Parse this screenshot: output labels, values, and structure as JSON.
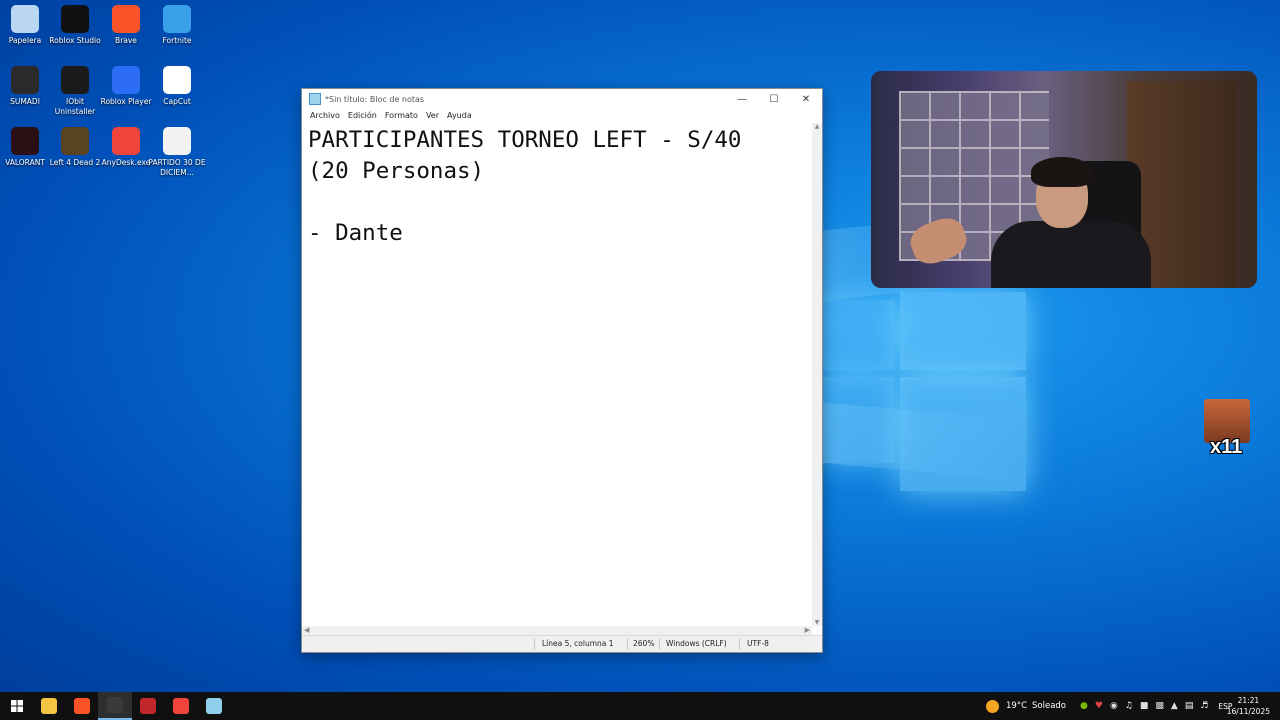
{
  "desktop": {
    "icons": [
      {
        "label": "Papelera",
        "icon": "recycle-bin-icon",
        "color": "#b9d7f0"
      },
      {
        "label": "Roblox Studio",
        "icon": "roblox-studio-icon",
        "color": "#111111"
      },
      {
        "label": "Brave",
        "icon": "brave-icon",
        "color": "#fb542b"
      },
      {
        "label": "Fortnite",
        "icon": "fortnite-icon",
        "color": "#3aa0e8"
      },
      {
        "label": "SUMADI",
        "icon": "sumadi-icon",
        "color": "#2a2a2a"
      },
      {
        "label": "IObit Uninstaller",
        "icon": "iobit-uninstaller-icon",
        "color": "#1a1a1a"
      },
      {
        "label": "Roblox Player",
        "icon": "roblox-player-icon",
        "color": "#2d6df6"
      },
      {
        "label": "CapCut",
        "icon": "capcut-icon",
        "color": "#ffffff"
      },
      {
        "label": "VALORANT",
        "icon": "valorant-icon",
        "color": "#2a0f14"
      },
      {
        "label": "Left 4 Dead 2",
        "icon": "left4dead2-icon",
        "color": "#5a4320"
      },
      {
        "label": "AnyDesk.exe",
        "icon": "anydesk-icon",
        "color": "#ef443b"
      },
      {
        "label": "PARTIDO 30 DE DICIEM...",
        "icon": "text-file-icon",
        "color": "#f2f2f2"
      }
    ]
  },
  "notepad": {
    "title": "*Sin título: Bloc de notas",
    "menu": [
      "Archivo",
      "Edición",
      "Formato",
      "Ver",
      "Ayuda"
    ],
    "content": "PARTICIPANTES TORNEO LEFT - S/40\n(20 Personas)\n\n- Dante",
    "status": {
      "position": "Línea 5, columna 1",
      "zoom": "260%",
      "line_endings": "Windows (CRLF)",
      "encoding": "UTF-8"
    }
  },
  "overlay": {
    "emote_count": "x11"
  },
  "taskbar": {
    "apps": [
      {
        "icon": "file-explorer-icon",
        "color": "#f4c542"
      },
      {
        "icon": "brave-icon",
        "color": "#fb542b"
      },
      {
        "icon": "obs-icon",
        "color": "#3a3a3a"
      },
      {
        "icon": "voicemeeter-icon",
        "color": "#c0272d"
      },
      {
        "icon": "anydesk-icon",
        "color": "#ef443b"
      },
      {
        "icon": "notepad-icon",
        "color": "#8fd0ee"
      }
    ],
    "weather": {
      "temp": "19°C",
      "condition": "Soleado"
    },
    "language": "ESP",
    "time": "21:21",
    "date": "16/11/2025"
  }
}
